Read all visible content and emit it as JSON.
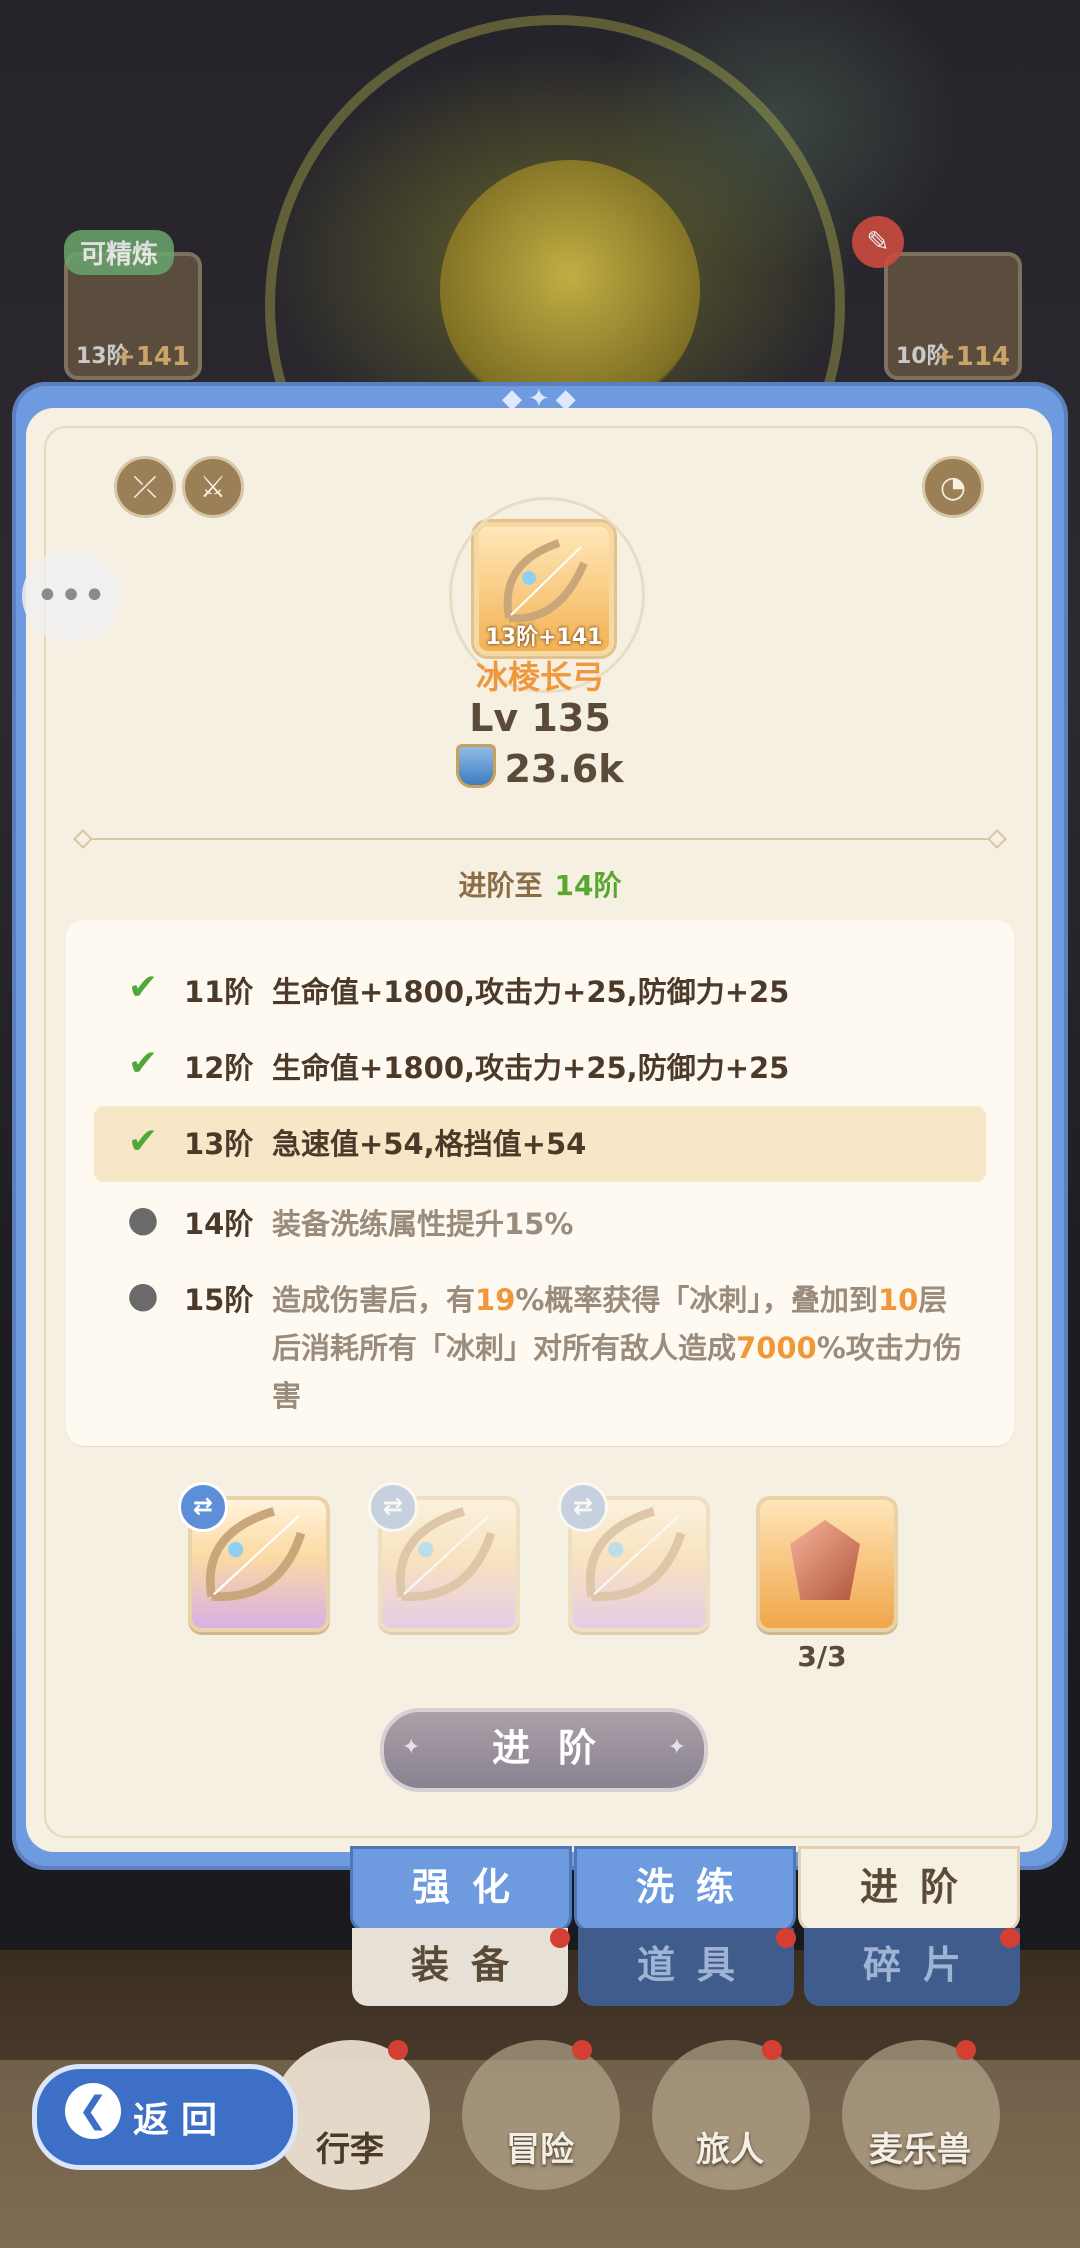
{
  "header_cards": {
    "left": {
      "tag": "可精炼",
      "tier": "13阶",
      "plus": "+141"
    },
    "right": {
      "tier": "10阶",
      "plus": "+114"
    }
  },
  "item": {
    "tier_badge": "13阶+141",
    "name": "冰棱长弓",
    "level": "Lv 135",
    "power": "23.6k"
  },
  "advance_to": {
    "label": "进阶至",
    "tier": "14阶"
  },
  "stats": [
    {
      "tier": "11阶",
      "text": "生命值+1800,攻击力+25,防御力+25",
      "status": "done"
    },
    {
      "tier": "12阶",
      "text": "生命值+1800,攻击力+25,防御力+25",
      "status": "done"
    },
    {
      "tier": "13阶",
      "text": "急速值+54,格挡值+54",
      "status": "current"
    },
    {
      "tier": "14阶",
      "text": "装备洗练属性提升15%",
      "status": "locked"
    },
    {
      "tier": "15阶",
      "text_parts": [
        "造成伤害后，有",
        "19",
        "%概率获得「冰刺」，叠加到",
        "10",
        "层后消耗所有「冰刺」对所有敌人造成",
        "7000",
        "%攻击力伤害"
      ],
      "status": "locked"
    }
  ],
  "materials": {
    "count": "3/3"
  },
  "advance_button": "进阶",
  "tabs": {
    "enhance": "强化",
    "refine": "洗练",
    "advance": "进阶"
  },
  "bag_tabs": {
    "equipment": "装备",
    "items": "道具",
    "fragments": "碎片"
  },
  "nav": {
    "back": "返回",
    "bag": "行李",
    "adventure": "冒险",
    "traveler": "旅人",
    "pet": "麦乐兽"
  },
  "colors": {
    "accent_orange": "#f0973a",
    "check_green": "#4fa83a",
    "panel_blue": "#6e9be0"
  }
}
